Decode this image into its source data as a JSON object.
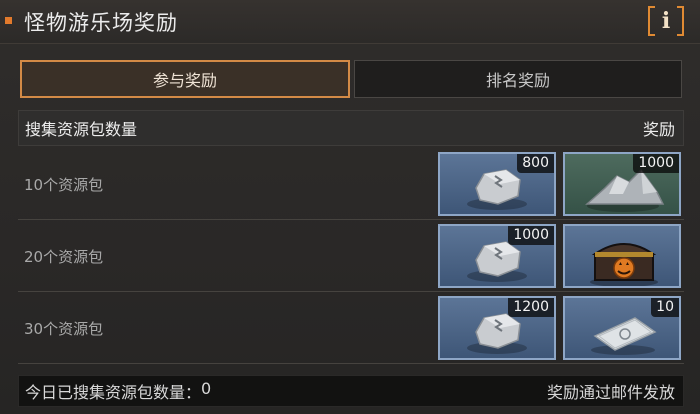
{
  "header": {
    "title": "怪物游乐场奖励",
    "info_glyph": "i",
    "accent": "#e27a2c"
  },
  "tabs": [
    {
      "label": "参与奖励",
      "active": true
    },
    {
      "label": "排名奖励",
      "active": false
    }
  ],
  "table": {
    "col_left": "搜集资源包数量",
    "col_right": "奖励",
    "rows": [
      {
        "label": "10个资源包",
        "rewards": [
          {
            "icon": "metal-ore-icon",
            "count": "800"
          },
          {
            "icon": "rock-pile-icon",
            "count": "1000"
          }
        ]
      },
      {
        "label": "20个资源包",
        "rewards": [
          {
            "icon": "metal-ore-icon",
            "count": "1000"
          },
          {
            "icon": "treasure-chest-icon",
            "count": ""
          }
        ]
      },
      {
        "label": "30个资源包",
        "rewards": [
          {
            "icon": "metal-ore-icon",
            "count": "1200"
          },
          {
            "icon": "supply-pack-icon",
            "count": "10"
          }
        ]
      }
    ]
  },
  "footer": {
    "collected_label": "今日已搜集资源包数量：",
    "collected_value": "0",
    "note": "奖励通过邮件发放"
  }
}
